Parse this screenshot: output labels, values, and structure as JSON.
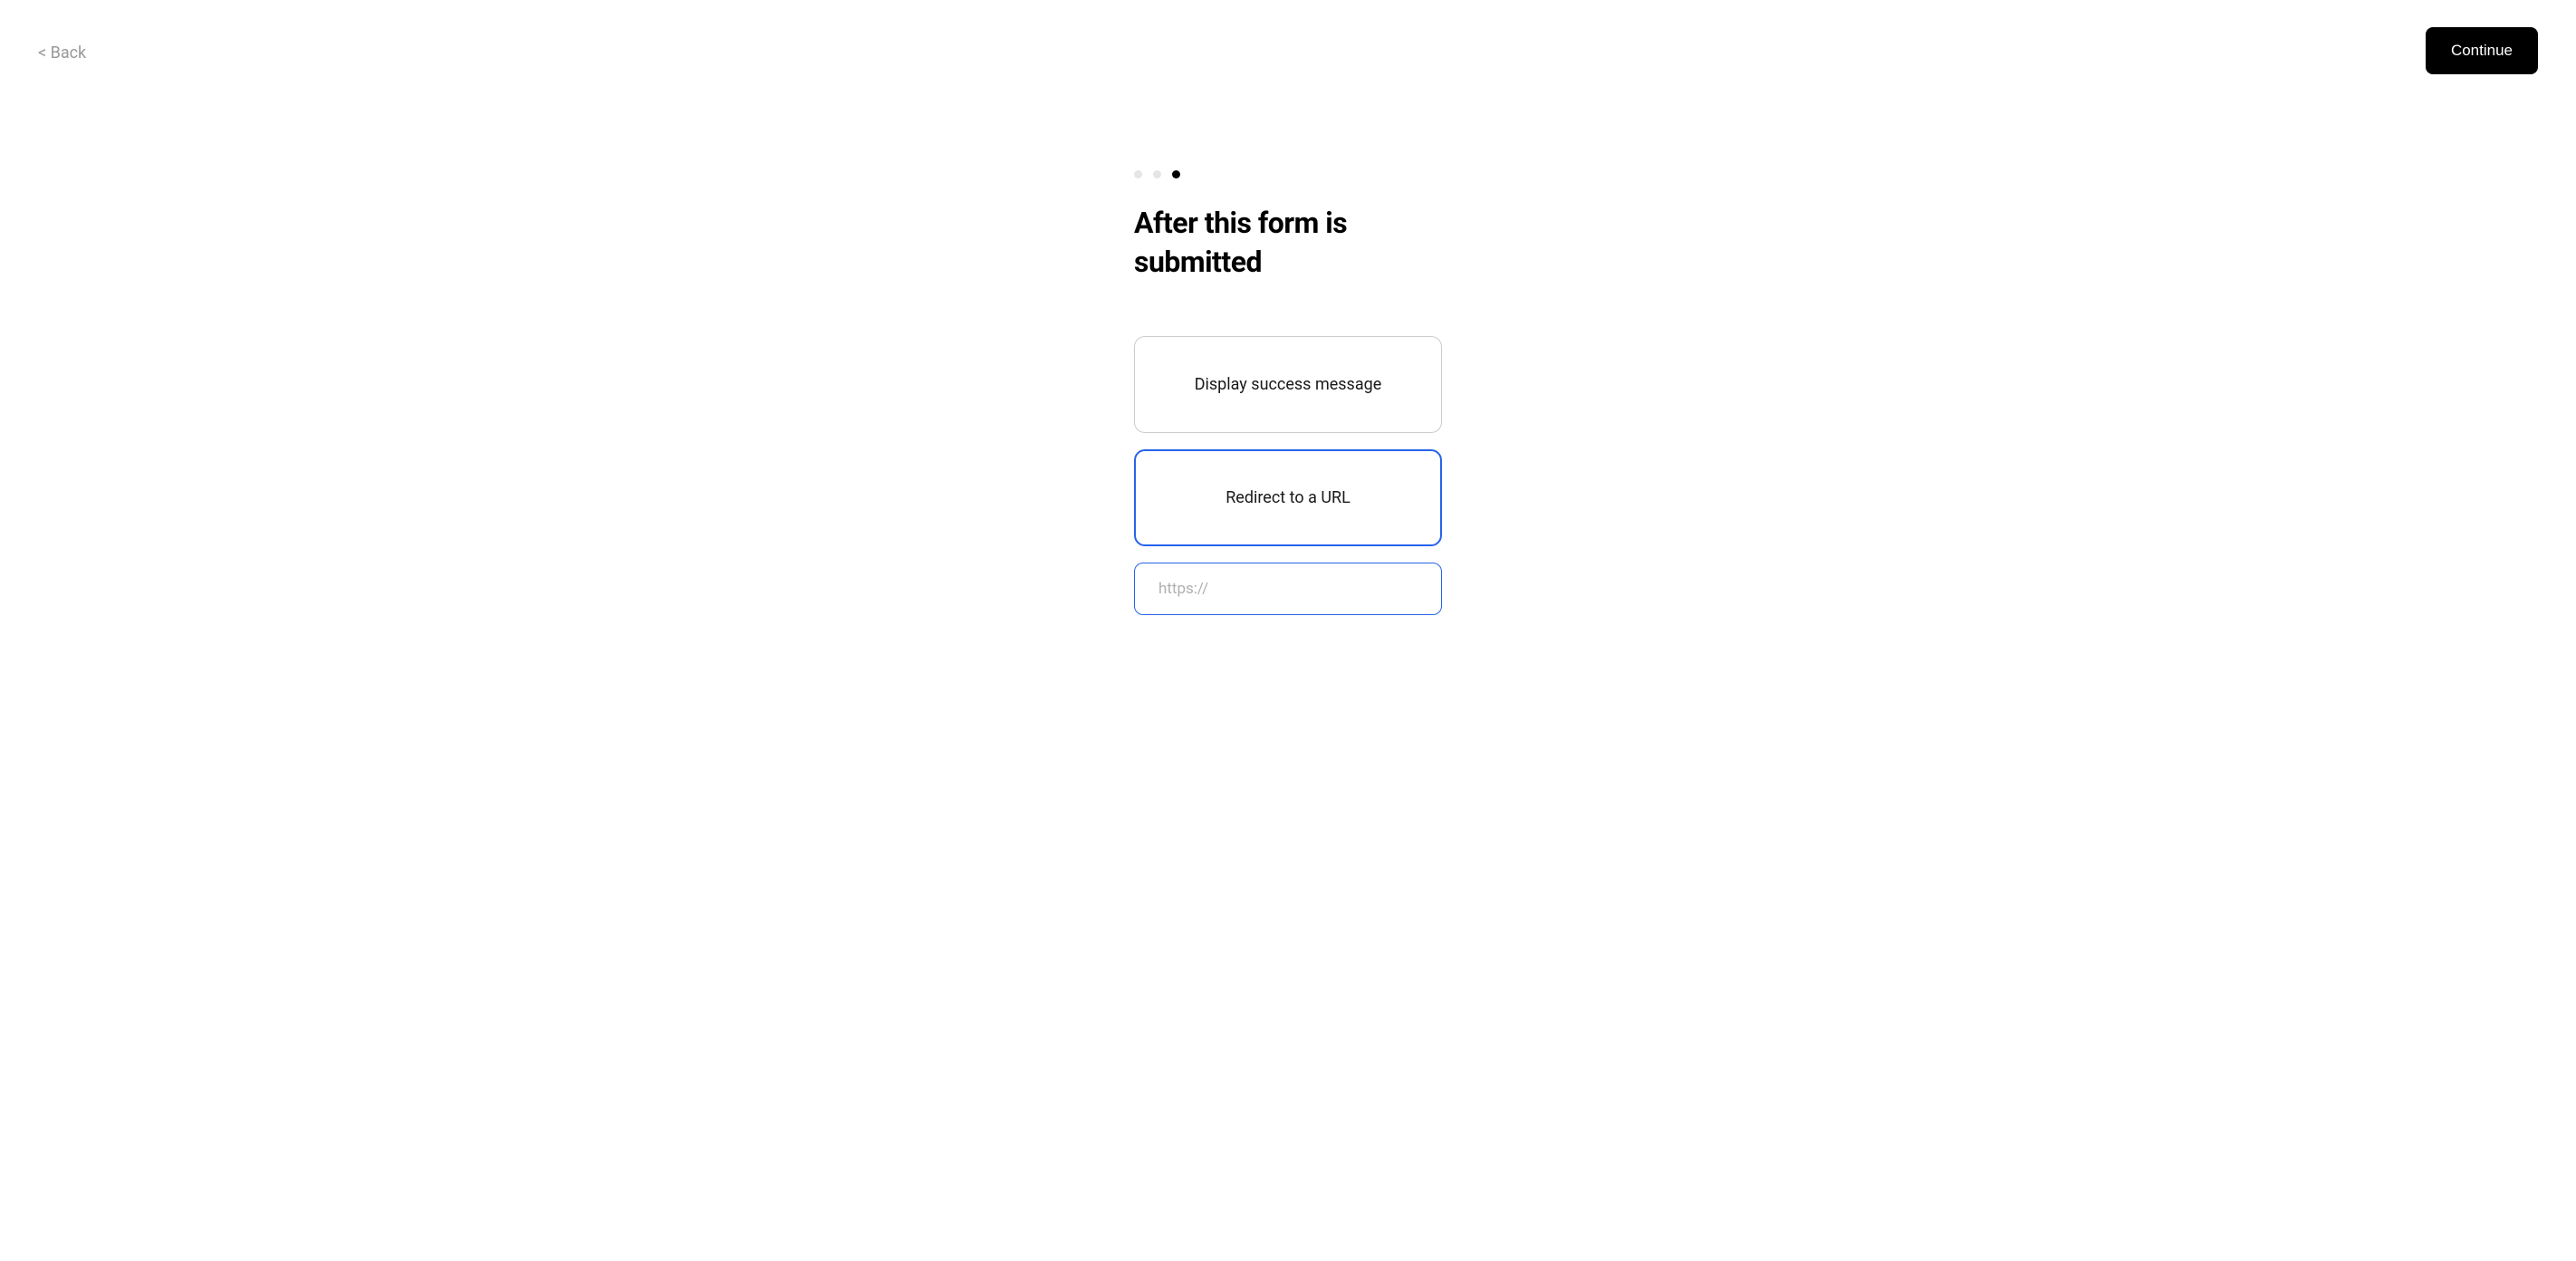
{
  "header": {
    "back_label": "< Back",
    "continue_label": "Continue"
  },
  "progress": {
    "total": 3,
    "current": 3
  },
  "main": {
    "title": "After this form is submitted",
    "options": [
      {
        "label": "Display success message",
        "selected": false
      },
      {
        "label": "Redirect to a URL",
        "selected": true
      }
    ],
    "url_input": {
      "placeholder": "https://",
      "value": ""
    }
  }
}
